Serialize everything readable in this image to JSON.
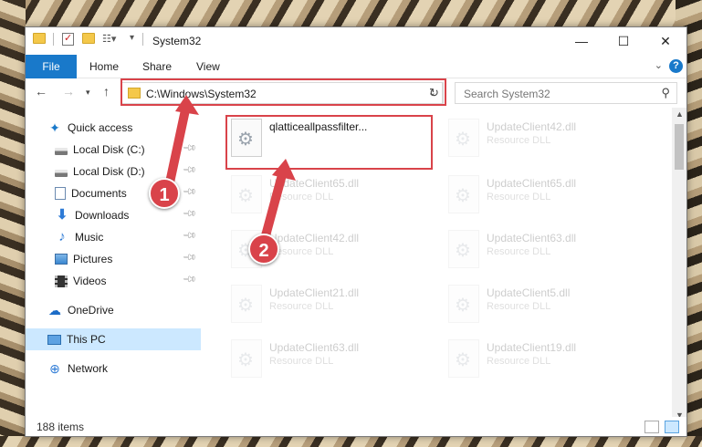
{
  "window": {
    "title": "System32"
  },
  "ribbon": {
    "file": "File",
    "tabs": [
      "Home",
      "Share",
      "View"
    ],
    "help": "?"
  },
  "address": {
    "path": "C:\\Windows\\System32",
    "search_placeholder": "Search System32"
  },
  "sidebar": {
    "items": [
      {
        "label": "Quick access",
        "icon": "star-icon",
        "pinned": false
      },
      {
        "label": "Local Disk (C:)",
        "icon": "disk-icon",
        "pinned": true
      },
      {
        "label": "Local Disk (D:)",
        "icon": "disk-icon",
        "pinned": true
      },
      {
        "label": "Documents",
        "icon": "documents-icon",
        "pinned": true
      },
      {
        "label": "Downloads",
        "icon": "downloads-icon",
        "pinned": true
      },
      {
        "label": "Music",
        "icon": "music-icon",
        "pinned": true
      },
      {
        "label": "Pictures",
        "icon": "pictures-icon",
        "pinned": true
      },
      {
        "label": "Videos",
        "icon": "videos-icon",
        "pinned": true
      },
      {
        "label": "OneDrive",
        "icon": "onedrive-icon",
        "pinned": false
      },
      {
        "label": "This PC",
        "icon": "this-pc-icon",
        "pinned": false,
        "selected": true
      },
      {
        "label": "Network",
        "icon": "network-icon",
        "pinned": false
      }
    ]
  },
  "files": [
    {
      "name": "qlatticeallpassfilter...",
      "type": "",
      "faded": false
    },
    {
      "name": "UpdateClient42.dll",
      "type": "Resource DLL",
      "faded": true
    },
    {
      "name": "UpdateClient65.dll",
      "type": "Resource DLL",
      "faded": true
    },
    {
      "name": "UpdateClient65.dll",
      "type": "Resource DLL",
      "faded": true
    },
    {
      "name": "UpdateClient42.dll",
      "type": "Resource DLL",
      "faded": true
    },
    {
      "name": "UpdateClient63.dll",
      "type": "Resource DLL",
      "faded": true
    },
    {
      "name": "UpdateClient21.dll",
      "type": "Resource DLL",
      "faded": true
    },
    {
      "name": "UpdateClient5.dll",
      "type": "Resource DLL",
      "faded": true
    },
    {
      "name": "UpdateClient63.dll",
      "type": "Resource DLL",
      "faded": true
    },
    {
      "name": "UpdateClient19.dll",
      "type": "Resource DLL",
      "faded": true
    }
  ],
  "status": {
    "count": "188 items"
  },
  "annotations": {
    "badge1": "1",
    "badge2": "2",
    "highlight_color": "#d9434a"
  }
}
